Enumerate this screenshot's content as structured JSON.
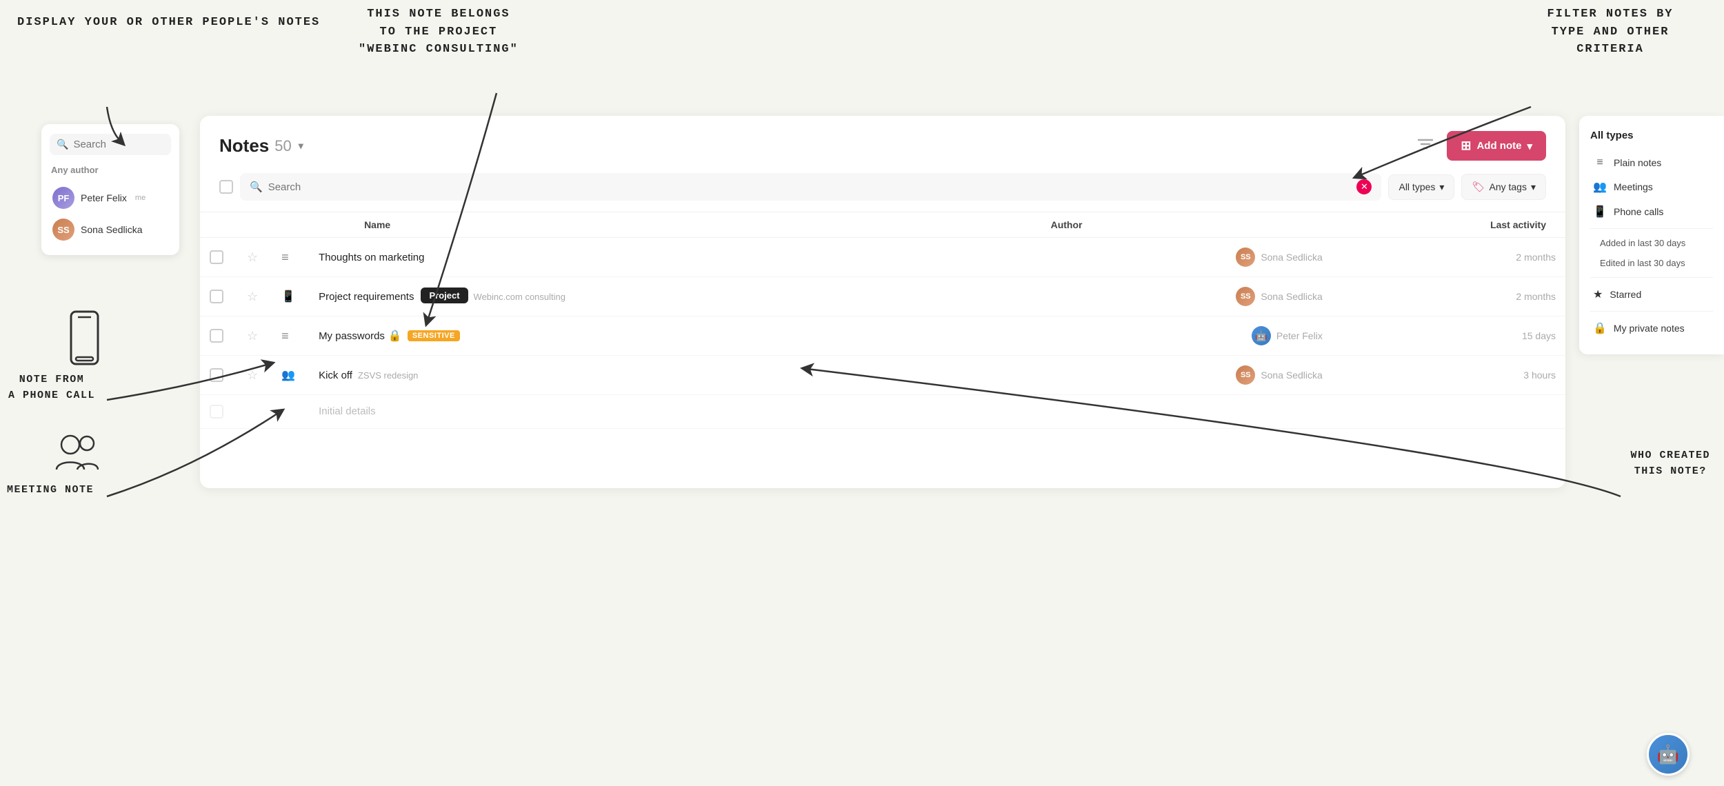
{
  "annotations": {
    "display_your": "DISPLAY YOUR\nOR OTHER PEOPLE'S\nNOTES",
    "note_belongs": "THIS NOTE BELONGS\nTO THE PROJECT\n\"WEBINC CONSULTING\"",
    "filter_notes": "FILTER NOTES BY\nTYPE AND OTHER\nCRITERIA",
    "note_phone": "NOTE FROM\nA PHONE CALL",
    "meeting_note": "MEETING NOTE",
    "who_created": "WHO CREATED\nTHIS NOTE?"
  },
  "sidebar": {
    "search_placeholder": "Search",
    "author_label": "Any author",
    "users": [
      {
        "name": "Peter Felix",
        "tag": "me",
        "initials": "PF",
        "color": "av-pf"
      },
      {
        "name": "Sona Sedlicka",
        "tag": "",
        "initials": "SS",
        "color": "av-ss"
      }
    ]
  },
  "main": {
    "title": "Notes",
    "count": "50",
    "search_placeholder": "Search",
    "filter_types_label": "All types",
    "filter_tags_label": "Any tags",
    "add_note_label": "Add note",
    "table": {
      "headers": {
        "name": "Name",
        "author": "Author",
        "activity": "Last activity"
      },
      "rows": [
        {
          "type": "plain",
          "type_icon": "≡",
          "name": "Thoughts on marketing",
          "project": "",
          "badge": "",
          "author_name": "Sona Sedlicka",
          "activity": "2 months",
          "avatar_class": "av-ss",
          "avatar_initials": "SS"
        },
        {
          "type": "phone",
          "type_icon": "📱",
          "name": "Project requirements",
          "project": "Webinc.com consulting",
          "tooltip": "Project",
          "badge": "",
          "author_name": "Sona Sedlicka",
          "activity": "2 months",
          "avatar_class": "av-ss2",
          "avatar_initials": "SS"
        },
        {
          "type": "plain",
          "type_icon": "≡",
          "name": "My passwords",
          "project": "",
          "badge": "SENSITIVE",
          "has_lock": true,
          "author_name": "Peter Felix",
          "activity": "15 days",
          "avatar_class": "av-robot",
          "avatar_initials": "🤖"
        },
        {
          "type": "meeting",
          "type_icon": "👥",
          "name": "Kick off",
          "project": "ZSVS redesign",
          "badge": "",
          "author_name": "Sona Sedlicka",
          "activity": "3 hours",
          "avatar_class": "av-ss3",
          "avatar_initials": "SS"
        }
      ]
    }
  },
  "filter_panel": {
    "title": "All types",
    "items": [
      {
        "label": "Plain notes",
        "icon": "≡"
      },
      {
        "label": "Meetings",
        "icon": "👥"
      },
      {
        "label": "Phone calls",
        "icon": "📱"
      }
    ],
    "criteria": [
      {
        "label": "Added in last 30 days"
      },
      {
        "label": "Edited in last 30 days"
      },
      {
        "label": "Starred",
        "icon_star": true
      },
      {
        "label": "My private notes",
        "icon_lock": true
      }
    ]
  },
  "icons": {
    "search": "🔍",
    "filter": "☰",
    "dropdown_arrow": "▾",
    "star_empty": "☆",
    "tag": "🏷",
    "plus": "+",
    "close": "✕",
    "lock": "🔒",
    "star_filled": "★"
  }
}
